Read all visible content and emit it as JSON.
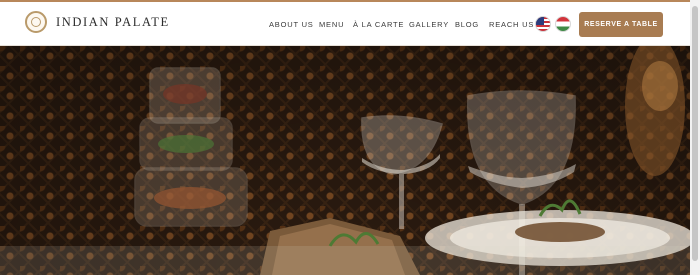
{
  "brand": {
    "name": "INDIAN PALATE",
    "logo_icon": "mandala-emblem-icon"
  },
  "nav": {
    "links": [
      "ABOUT US",
      "MENU",
      "À LA CARTE",
      "GALLERY",
      "BLOG",
      "REACH US"
    ]
  },
  "languages": [
    {
      "name": "English",
      "icon": "us-flag-icon"
    },
    {
      "name": "Hungarian",
      "icon": "hungary-flag-icon"
    }
  ],
  "cta": {
    "label": "RESERVE A TABLE"
  },
  "colors": {
    "accent": "#a87c52",
    "navbar_bg": "#ffffff",
    "text": "#3a3a3a"
  }
}
